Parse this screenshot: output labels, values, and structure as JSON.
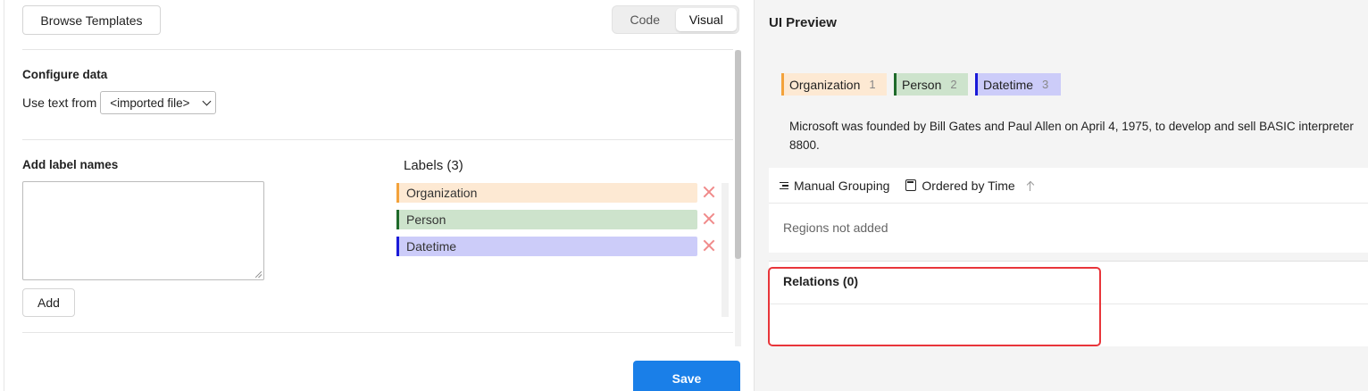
{
  "toolbar": {
    "browse_templates": "Browse Templates",
    "mode_code": "Code",
    "mode_visual": "Visual",
    "active_mode": "Visual"
  },
  "configure": {
    "title": "Configure data",
    "use_text_from_label": "Use text from",
    "source_value": "<imported file>"
  },
  "add_labels": {
    "title": "Add label names",
    "input_value": "",
    "add_button": "Add"
  },
  "labels": {
    "title": "Labels (3)",
    "items": [
      {
        "name": "Organization",
        "bar_color": "#f3a23b",
        "bg_color": "#fde9d3"
      },
      {
        "name": "Person",
        "bar_color": "#1f6a2a",
        "bg_color": "#cde3cc"
      },
      {
        "name": "Datetime",
        "bar_color": "#1a1ad8",
        "bg_color": "#ccccf9"
      }
    ]
  },
  "save_button": "Save",
  "preview": {
    "title": "UI Preview",
    "chips": [
      {
        "name": "Organization",
        "hotkey": "1",
        "bar_color": "#f3a23b",
        "bg_color": "#fde9d3"
      },
      {
        "name": "Person",
        "hotkey": "2",
        "bar_color": "#1f6a2a",
        "bg_color": "#cde3cc"
      },
      {
        "name": "Datetime",
        "hotkey": "3",
        "bar_color": "#1a1ad8",
        "bg_color": "#ccccf9"
      }
    ],
    "text_line1": "Microsoft was founded by Bill Gates and Paul Allen on April 4, 1975, to develop and sell BASIC interpreter",
    "text_line2": "8800.",
    "manual_grouping": "Manual Grouping",
    "ordered_by_time": "Ordered by Time",
    "regions_empty": "Regions not added",
    "relations_title": "Relations (0)"
  },
  "colors": {
    "accent": "#1a7fe8",
    "highlight": "#e8353a",
    "delete": "#f08a8a"
  }
}
